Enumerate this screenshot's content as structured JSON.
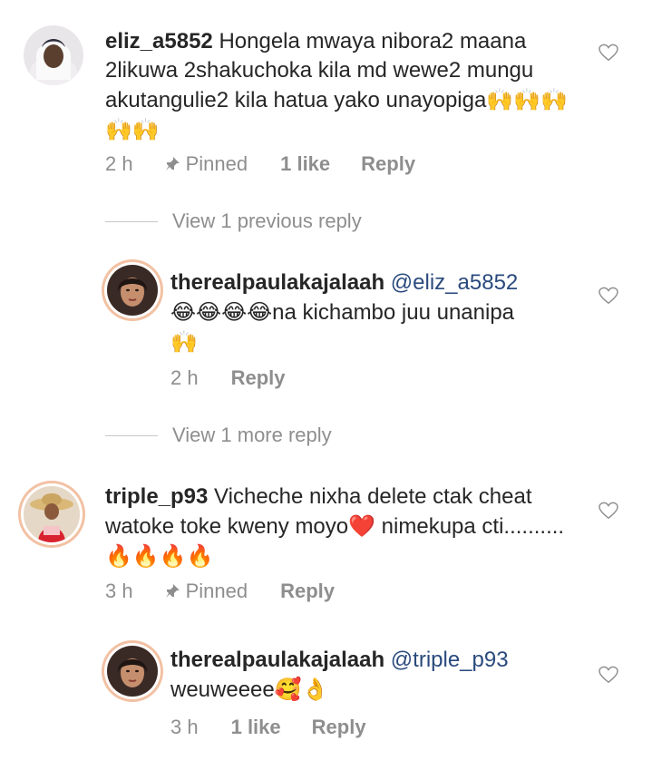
{
  "comments": [
    {
      "username": "eliz_a5852",
      "text": " Hongela mwaya nibora2 maana 2likuwa 2shakuchoka kila md wewe2 mungu akutangulie2 kila hatua yako unayopiga",
      "emoji_tail": "🙌🙌🙌🙌🙌",
      "time": "2 h",
      "pinned_label": "Pinned",
      "likes": "1 like",
      "reply_label": "Reply",
      "avatar_icon": "user-hijab-avatar"
    },
    {
      "username": "therealpaulakajalaah",
      "mention": "@eliz_a5852",
      "emoji_lead": "😂😂😂😂",
      "text": "na kichambo juu unanipa",
      "emoji_tail": "🙌",
      "time": "2 h",
      "reply_label": "Reply",
      "avatar_icon": "woman-avatar"
    },
    {
      "username": "triple_p93",
      "text": " Vicheche nixha delete ctak cheat watoke toke kweny moyo",
      "emoji_mid": "❤️",
      "text2": " nimekupa cti..........",
      "emoji_tail": "🔥🔥🔥🔥",
      "time": "3 h",
      "pinned_label": "Pinned",
      "reply_label": "Reply",
      "avatar_icon": "hat-avatar"
    },
    {
      "username": "therealpaulakajalaah",
      "mention": "@triple_p93",
      "text": "weuweeee",
      "emoji_tail": "🥰👌",
      "time": "3 h",
      "likes": "1 like",
      "reply_label": "Reply",
      "avatar_icon": "woman-avatar"
    }
  ],
  "view_previous": "View 1 previous reply",
  "view_more": "View 1 more reply",
  "colors": {
    "text": "#262626",
    "meta": "#8e8e8e",
    "mention": "#2a4a7d",
    "ring": "#f2c1a3"
  }
}
